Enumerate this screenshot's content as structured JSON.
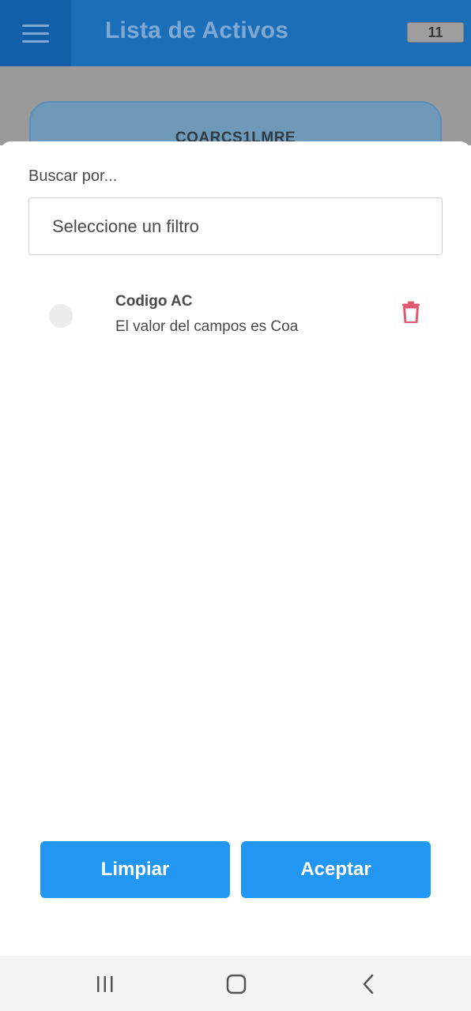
{
  "app": {
    "title": "Lista de Activos",
    "count_badge": "11",
    "asset_card_code": "COARCS1LMRE"
  },
  "filter_sheet": {
    "label": "Buscar por...",
    "select_placeholder": "Seleccione un filtro",
    "filters": [
      {
        "title": "Codigo AC",
        "description": "El valor del campos es Coa",
        "selected": false
      }
    ],
    "clear_button": "Limpiar",
    "accept_button": "Aceptar"
  },
  "icons": {
    "menu": "menu-icon",
    "delete": "trash-icon",
    "nav_recent": "recent-apps-icon",
    "nav_home": "home-icon",
    "nav_back": "back-icon"
  },
  "colors": {
    "appbar": "#1b6eb8",
    "primary_button": "#2196f3",
    "delete_icon": "#e05a73"
  }
}
